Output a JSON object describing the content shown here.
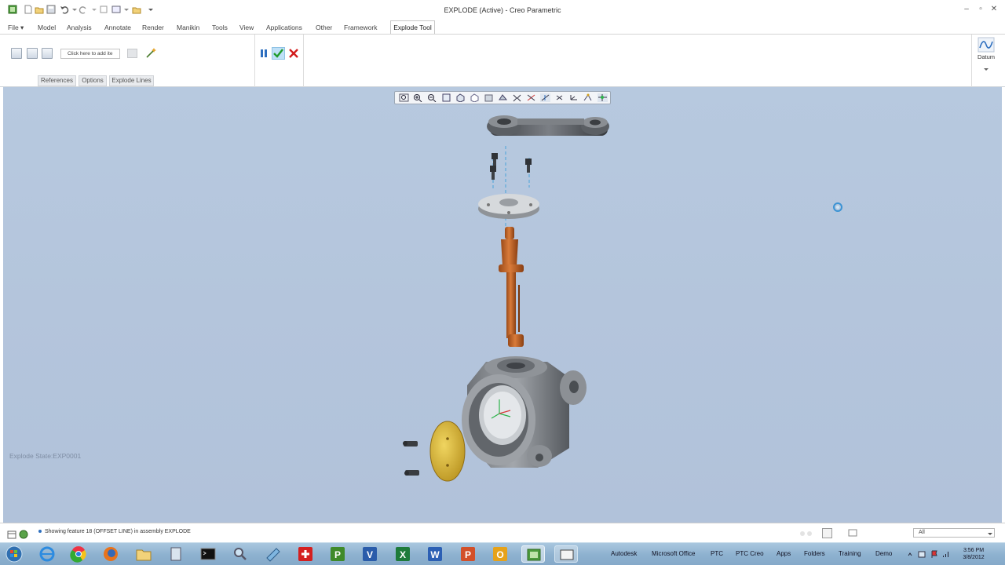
{
  "window": {
    "title": "EXPLODE (Active) - Creo Parametric"
  },
  "menu_tabs": [
    {
      "label": "File ▾"
    },
    {
      "label": "Model"
    },
    {
      "label": "Analysis"
    },
    {
      "label": "Annotate"
    },
    {
      "label": "Render"
    },
    {
      "label": "Manikin"
    },
    {
      "label": "Tools"
    },
    {
      "label": "View"
    },
    {
      "label": "Applications"
    },
    {
      "label": "Other"
    },
    {
      "label": "Framework"
    },
    {
      "label": "Explode Tool"
    }
  ],
  "ribbon": {
    "collector_placeholder": "Click here to add ite",
    "subtabs": [
      {
        "label": "References"
      },
      {
        "label": "Options"
      },
      {
        "label": "Explode Lines"
      }
    ],
    "datum_label": "Datum"
  },
  "viewport": {
    "explode_state": "Explode State:EXP0001"
  },
  "status": {
    "message": "Showing feature 18 (OFFSET LINE) in assembly EXPLODE",
    "filter_value": "All"
  },
  "taskbar": {
    "folders": [
      {
        "label": "Autodesk"
      },
      {
        "label": "Microsoft Office"
      },
      {
        "label": "PTC"
      },
      {
        "label": "PTC Creo"
      },
      {
        "label": "Apps"
      },
      {
        "label": "Folders"
      },
      {
        "label": "Training"
      },
      {
        "label": "Demo"
      }
    ],
    "time": "3:56 PM",
    "date": "3/8/2012"
  },
  "colors": {
    "accent": "#2e6fbf",
    "ok": "#1f9b2a",
    "cancel": "#d21c1c",
    "viewport_bg": "#b5c7de",
    "shaft": "#c8682a",
    "cover": "#d6b43a"
  }
}
